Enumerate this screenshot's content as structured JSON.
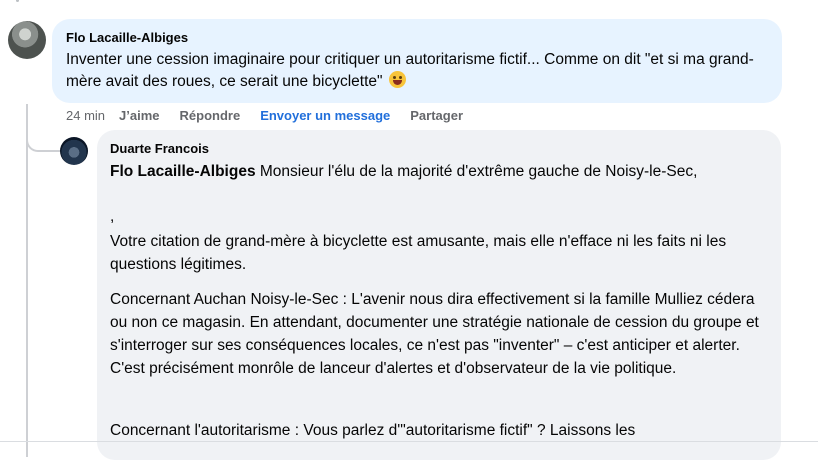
{
  "comment": {
    "author": "Flo Lacaille-Albiges",
    "text": "Inventer une cession imaginaire pour critiquer un autoritarisme fictif... Comme on dit \"et si ma grand-mère avait des roues, ce serait une bicyclette\"",
    "emoji_icon": "grinning-squinting-face"
  },
  "actions": {
    "time": "24 min",
    "like": "J’aime",
    "reply": "Répondre",
    "message": "Envoyer un message",
    "share": "Partager"
  },
  "reply": {
    "author": "Duarte Francois",
    "mention": "Flo Lacaille-Albiges",
    "p1_rest": " Monsieur l'élu de la majorité d'extrême gauche de Noisy-le-Sec,",
    "p2": ",",
    "p3": "Votre citation de grand-mère à bicyclette est amusante, mais elle n'efface ni les faits ni les questions légitimes.",
    "p4": "Concernant Auchan Noisy-le-Sec : L'avenir nous dira effectivement si la famille Mulliez cédera ou non ce magasin. En attendant, documenter une stratégie nationale de cession du groupe et s'interroger sur ses conséquences locales, ce n'est pas \"inventer\" – c'est anticiper et alerter. C'est précisément monrôle de lanceur d'alertes et d'observateur de la vie politique.",
    "p5": "Concernant l'autoritarisme : Vous parlez d'\"autoritarisme fictif\" ? Laissons les"
  }
}
